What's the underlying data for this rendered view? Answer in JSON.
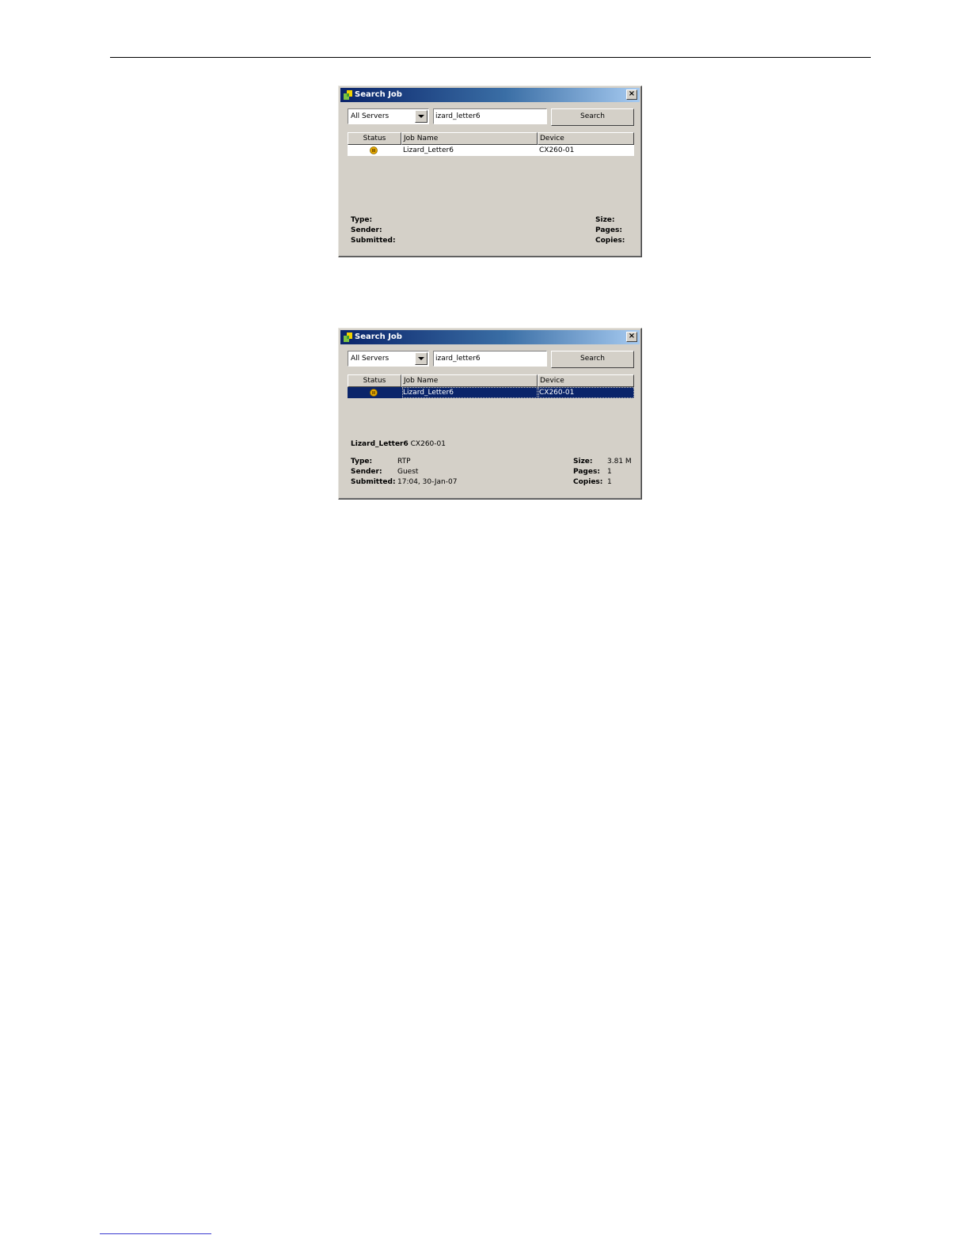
{
  "dialogs": [
    {
      "title": "Search Job",
      "close_glyph": "×",
      "server_select": "All Servers",
      "search_text": "izard_letter6",
      "search_button": "Search",
      "columns": {
        "status": "Status",
        "name": "Job Name",
        "device": "Device"
      },
      "row": {
        "name": "Lizard_Letter6",
        "device": "CX260-01",
        "selected": false,
        "status_icon": "paused-status-icon"
      },
      "labels": {
        "type": "Type:",
        "sender": "Sender:",
        "submitted": "Submitted:",
        "size": "Size:",
        "pages": "Pages:",
        "copies": "Copies:"
      }
    },
    {
      "title": "Search Job",
      "close_glyph": "×",
      "server_select": "All Servers",
      "search_text": "izard_letter6",
      "search_button": "Search",
      "columns": {
        "status": "Status",
        "name": "Job Name",
        "device": "Device"
      },
      "row": {
        "name": "Lizard_Letter6",
        "device": "CX260-01",
        "selected": true,
        "status_icon": "paused-status-icon"
      },
      "selected_job": {
        "name": "Lizard_Letter6",
        "device": "CX260-01"
      },
      "labels": {
        "type": "Type:",
        "sender": "Sender:",
        "submitted": "Submitted:",
        "size": "Size:",
        "pages": "Pages:",
        "copies": "Copies:"
      },
      "values": {
        "type": "RTP",
        "sender": "Guest",
        "submitted": "17:04, 30-Jan-07",
        "size": "3.81 M",
        "pages": "1",
        "copies": "1"
      }
    }
  ],
  "colors": {
    "dialog_bg": "#d4d0c8",
    "title_start": "#0a246a",
    "title_end": "#a6caf0",
    "selection": "#0a246a",
    "status_icon": "#e6a800"
  }
}
